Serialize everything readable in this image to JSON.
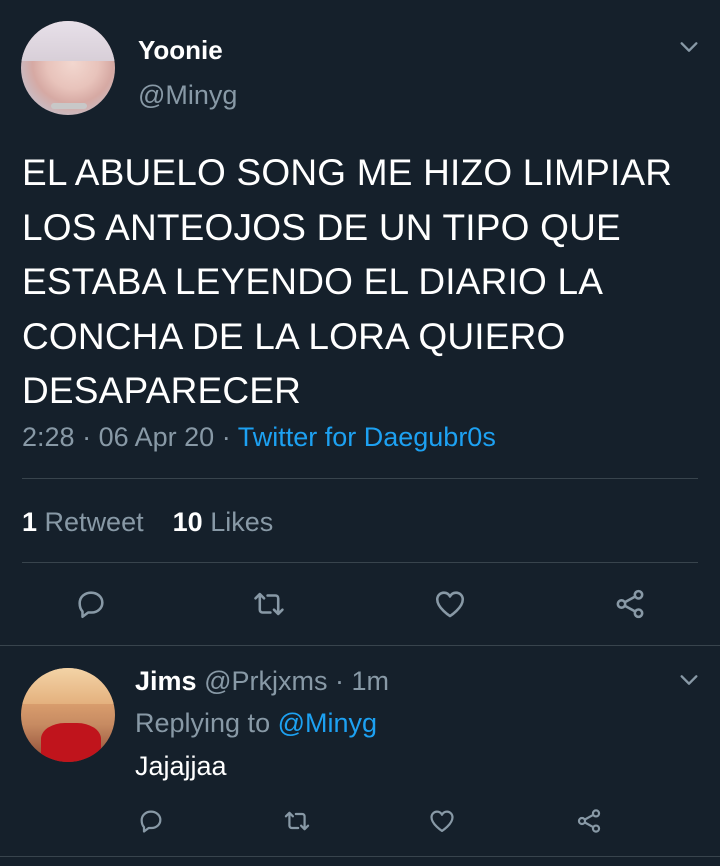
{
  "tweet": {
    "display_name": "Yoonie",
    "handle": "@Minyg",
    "text": "EL ABUELO SONG ME HIZO LIMPIAR LOS ANTEOJOS DE UN TIPO QUE ESTABA LEYENDO EL DIARIO LA CONCHA DE LA LORA QUIERO DESAPARECER",
    "time": "2:28",
    "separator": "·",
    "date": "06 Apr 20",
    "source": "Twitter for Daegubr0s",
    "retweet_count": "1",
    "retweet_label": "Retweet",
    "like_count": "10",
    "like_label": "Likes"
  },
  "reply": {
    "display_name": "Jims",
    "handle": "@Prkjxms",
    "separator": "·",
    "age": "1m",
    "replying_prefix": "Replying to",
    "replying_handle": "@Minyg",
    "text": "Jajajjaa"
  },
  "icons": {
    "chevron": "chevron-down-icon",
    "reply": "reply-icon",
    "retweet": "retweet-icon",
    "like": "heart-icon",
    "share": "share-icon"
  },
  "colors": {
    "background": "#15202b",
    "text": "#ffffff",
    "muted": "#8899a6",
    "link": "#1da1f2",
    "divider": "#38444d"
  }
}
